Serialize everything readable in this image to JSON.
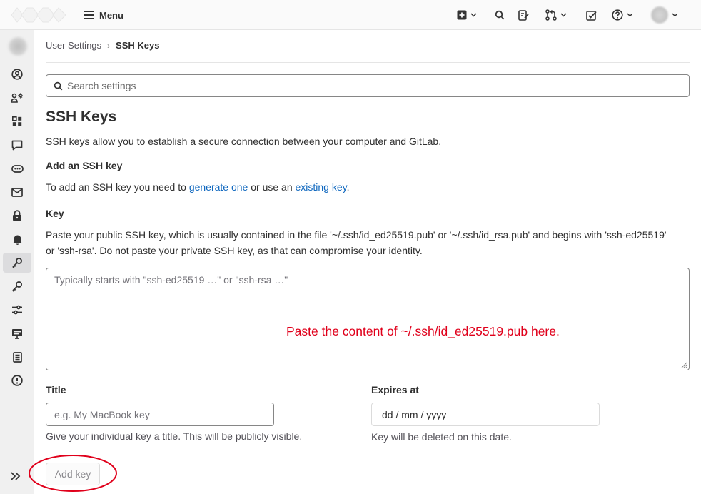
{
  "topbar": {
    "menu_label": "Menu",
    "icons": [
      "plus-icon",
      "search-icon",
      "issues-icon",
      "merge-request-icon",
      "todo-icon",
      "help-icon",
      "user-avatar"
    ]
  },
  "sidebar": {
    "items": [
      "profile",
      "account",
      "applications",
      "chat",
      "access-tokens",
      "emails",
      "password",
      "notifications",
      "ssh-keys",
      "gpg-keys",
      "preferences",
      "active-sessions",
      "authentication-log",
      "usage-quotas"
    ],
    "active": "ssh-keys"
  },
  "breadcrumb": {
    "parent": "User Settings",
    "separator": "›",
    "current": "SSH Keys"
  },
  "search": {
    "placeholder": "Search settings"
  },
  "page": {
    "title": "SSH Keys",
    "description": "SSH keys allow you to establish a secure connection between your computer and GitLab.",
    "add_heading": "Add an SSH key",
    "add_text_before": "To add an SSH key you need to ",
    "link_generate": "generate one",
    "add_text_middle": " or use an ",
    "link_existing": "existing key",
    "add_text_after": "."
  },
  "key_field": {
    "label": "Key",
    "help": "Paste your public SSH key, which is usually contained in the file '~/.ssh/id_ed25519.pub' or '~/.ssh/id_rsa.pub' and begins with 'ssh-ed25519' or 'ssh-rsa'. Do not paste your private SSH key, as that can compromise your identity.",
    "placeholder": "Typically starts with \"ssh-ed25519 …\" or \"ssh-rsa …\"",
    "annotation": "Paste the content of ~/.ssh/id_ed25519.pub here.",
    "annotation_color": "#e0001b"
  },
  "title_field": {
    "label": "Title",
    "placeholder": "e.g. My MacBook key",
    "help": "Give your individual key a title. This will be publicly visible."
  },
  "expires_field": {
    "label": "Expires at",
    "value": "dd / mm / yyyy",
    "help": "Key will be deleted on this date."
  },
  "add_button": {
    "label": "Add key",
    "highlight_color": "#e0001b"
  }
}
